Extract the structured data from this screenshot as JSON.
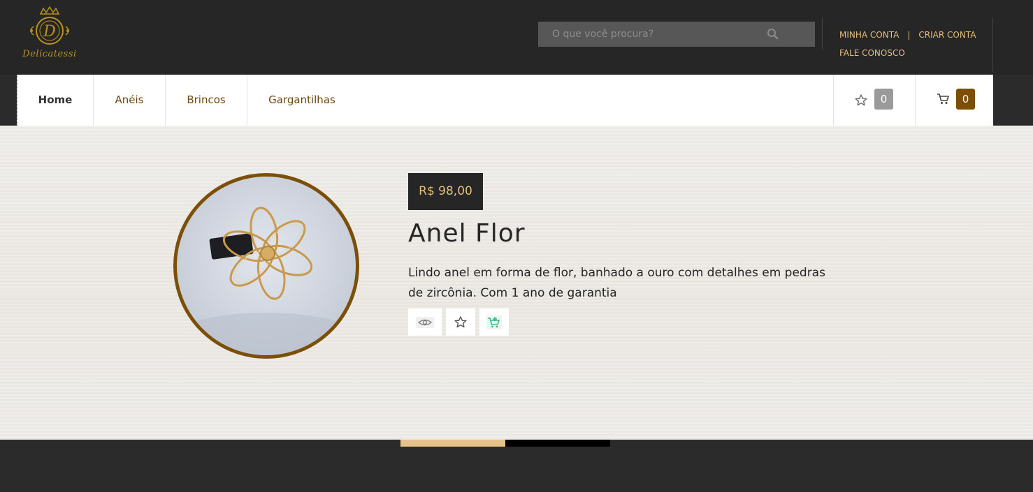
{
  "header": {
    "logo_text": "Delicatessi",
    "search_placeholder": "O que você procura?",
    "account_links": {
      "minha_conta": "MINHA CONTA",
      "separator": "|",
      "criar_conta": "CRIAR CONTA",
      "fale_conosco": "FALE CONOSCO"
    }
  },
  "nav": {
    "items": [
      {
        "label": "Home"
      },
      {
        "label": "Anéis"
      },
      {
        "label": "Brincos"
      },
      {
        "label": "Gargantilhas"
      }
    ],
    "wishlist_count": "0",
    "cart_count": "0"
  },
  "hero": {
    "price": "R$ 98,00",
    "title": "Anel Flor",
    "description": "Lindo anel em forma de flor, banhado a ouro com detalhes em pedras de zircônia. Com 1 ano de garantia"
  },
  "colors": {
    "gold": "#e4be7b",
    "brown": "#7b4f07",
    "dark": "#262626",
    "green": "#3bb58a"
  }
}
